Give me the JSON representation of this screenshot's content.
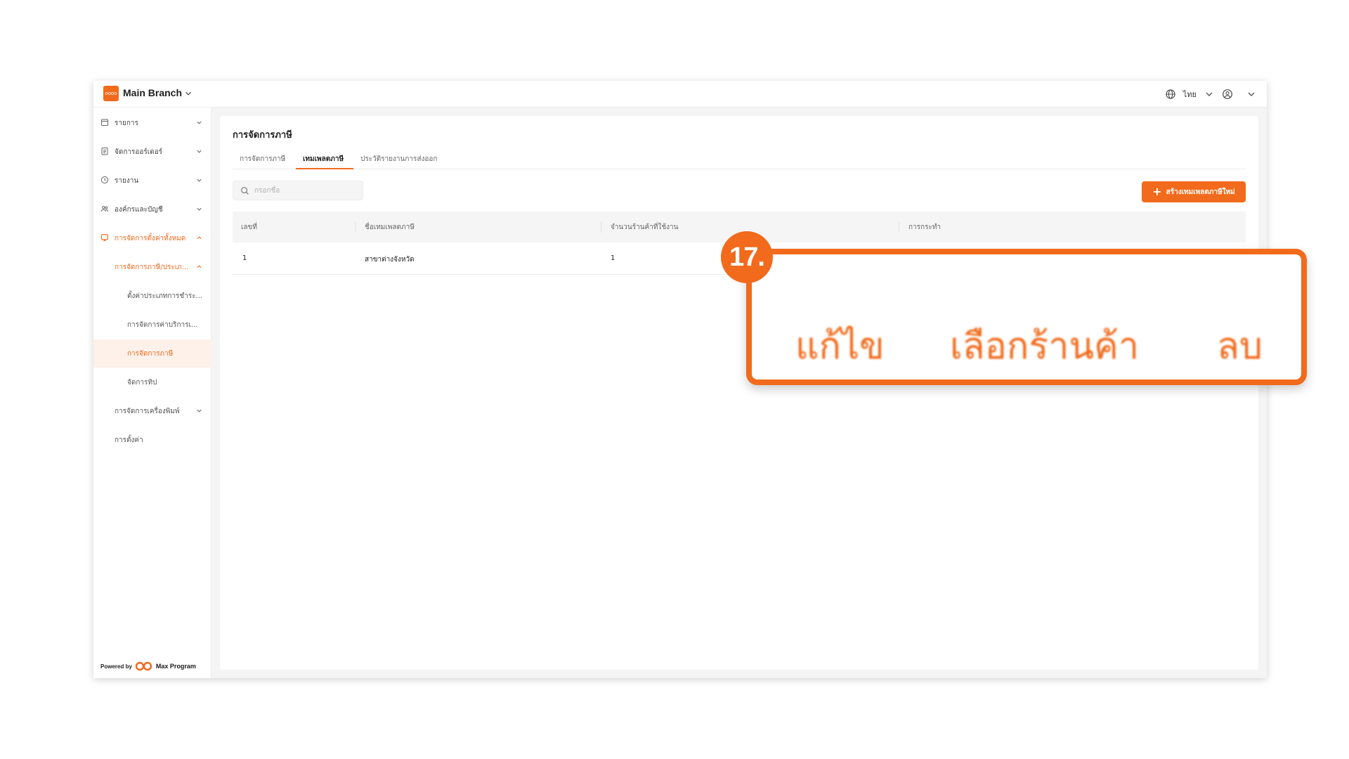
{
  "topbar": {
    "logo_text": "oooo",
    "branch_name": "Main Branch",
    "language": "ไทย"
  },
  "sidebar": {
    "items": [
      {
        "label": "รายการ"
      },
      {
        "label": "จัดการออร์เดอร์"
      },
      {
        "label": "รายงาน"
      },
      {
        "label": "องค์กรและบัญชี"
      },
      {
        "label": "การจัดการตั้งค่าทั้งหมด"
      },
      {
        "label": "การจัดการภาษี/ประเภ..."
      },
      {
        "label": "ตั้งค่าประเภทการชำระ..."
      },
      {
        "label": "การจัดการค่าบริการเ..."
      },
      {
        "label": "การจัดการภาษี"
      },
      {
        "label": "จัดการทิป"
      },
      {
        "label": "การจัดการเครื่องพิมพ์"
      },
      {
        "label": "การตั้งค่า"
      }
    ],
    "powered_by": "Powered by",
    "powered_name": "Max Program"
  },
  "main": {
    "page_title": "การจัดการภาษี",
    "tabs": [
      {
        "label": "การจัดการภาษี"
      },
      {
        "label": "เทมเพลตภาษี"
      },
      {
        "label": "ประวัติรายงานการส่งออก"
      }
    ],
    "search_placeholder": "กรอกชื่อ",
    "create_button": "สร้างเทมเพลตภาษีใหม่",
    "table": {
      "headers": [
        "เลขที่",
        "ชื่อเทมเพลตภาษี",
        "จำนวนร้านค้าที่ใช้งาน",
        "การกระทำ"
      ],
      "rows": [
        [
          "1",
          "สาขาต่างจังหวัด",
          "1"
        ]
      ]
    }
  },
  "callout": {
    "step": "17.",
    "actions": [
      "แก้ไข",
      "เลือกร้านค้า",
      "ลบ"
    ]
  },
  "colors": {
    "accent": "#f26a1b",
    "selected_bg": "#fdf1ea"
  }
}
